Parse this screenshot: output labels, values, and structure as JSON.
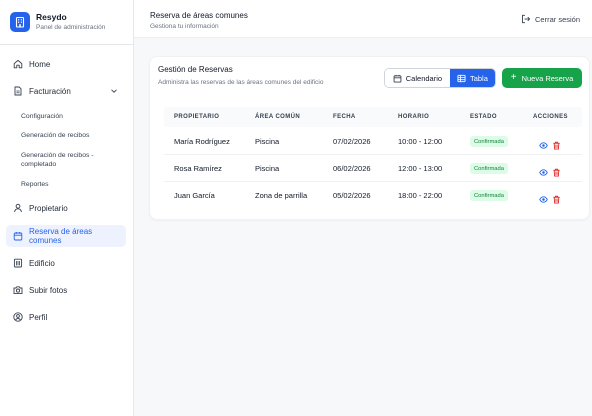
{
  "brand": {
    "name": "Resydo",
    "subtitle": "Panel de administración"
  },
  "sidebar": {
    "items": [
      {
        "label": "Home",
        "icon": "home-icon"
      },
      {
        "label": "Facturación",
        "icon": "document-icon"
      },
      {
        "label": "Propietario",
        "icon": "user-icon"
      },
      {
        "label": "Reserva de áreas comunes",
        "icon": "calendar-icon"
      },
      {
        "label": "Edificio",
        "icon": "building-icon"
      },
      {
        "label": "Subir fotos",
        "icon": "camera-icon"
      },
      {
        "label": "Perfil",
        "icon": "user-circle-icon"
      }
    ],
    "subitems": [
      {
        "label": "Configuración"
      },
      {
        "label": "Generación de recibos"
      },
      {
        "label": "Generación de recibos - completado"
      },
      {
        "label": "Reportes"
      }
    ]
  },
  "header": {
    "title": "Reserva de áreas comunes",
    "subtitle": "Gestiona tu información",
    "logout_label": "Cerrar sesión"
  },
  "card": {
    "title": "Gestión de Reservas",
    "subtitle": "Administra las reservas de las áreas comunes del edificio",
    "view_calendar": "Calendario",
    "view_table": "Tabla",
    "new_button": "Nueva Reserva"
  },
  "table": {
    "headers": [
      "PROPIETARIO",
      "ÁREA COMÚN",
      "FECHA",
      "HORARIO",
      "ESTADO",
      "ACCIONES"
    ],
    "rows": [
      {
        "owner": "María Rodríguez",
        "area": "Piscina",
        "date": "07/02/2026",
        "time": "10:00 - 12:00",
        "status": "Confirmada"
      },
      {
        "owner": "Rosa Ramírez",
        "area": "Piscina",
        "date": "06/02/2026",
        "time": "12:00 - 13:00",
        "status": "Confirmada"
      },
      {
        "owner": "Juan García",
        "area": "Zona de parrilla",
        "date": "05/02/2026",
        "time": "18:00 - 22:00",
        "status": "Confirmada"
      }
    ]
  },
  "colors": {
    "primary": "#2563eb",
    "success": "#16a34a",
    "danger": "#dc2626"
  }
}
